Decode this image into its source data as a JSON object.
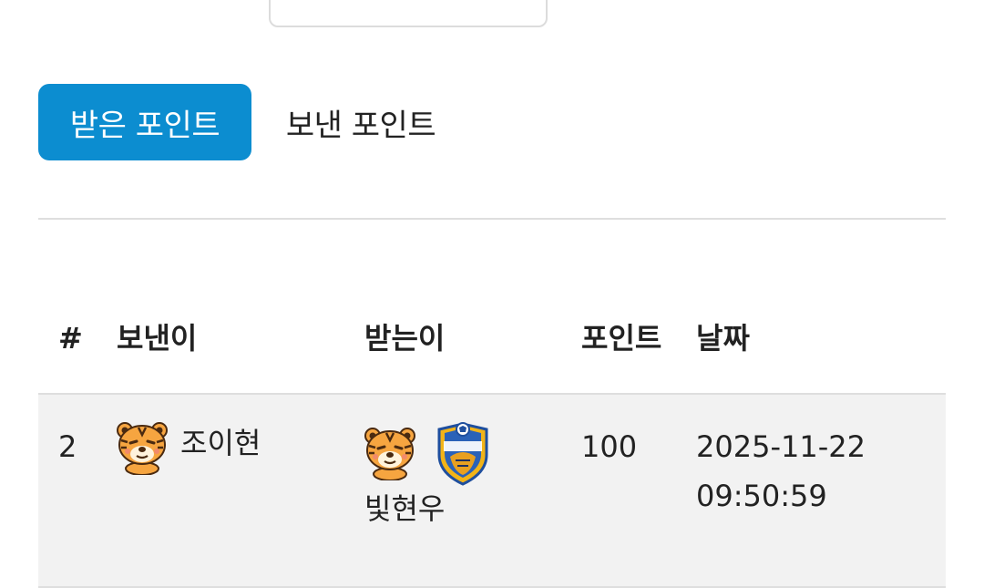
{
  "tabs": [
    {
      "label": "받은 포인트",
      "active": true
    },
    {
      "label": "보낸 포인트",
      "active": false
    }
  ],
  "table": {
    "headers": {
      "num": "#",
      "sender": "보낸이",
      "receiver": "받는이",
      "points": "포인트",
      "date": "날짜"
    },
    "rows": [
      {
        "num": "2",
        "sender": "조이현",
        "sender_avatar": "tiger-avatar-icon",
        "receiver": "빛현우",
        "receiver_avatar": "tiger-avatar-icon",
        "receiver_badge": "hyundai-team-badge-icon",
        "points": "100",
        "date": "2025-11-22",
        "time": "09:50:59"
      }
    ]
  },
  "colors": {
    "active_tab": "#0c8dd0",
    "row_background": "#f2f2f2",
    "divider": "#dedede"
  }
}
